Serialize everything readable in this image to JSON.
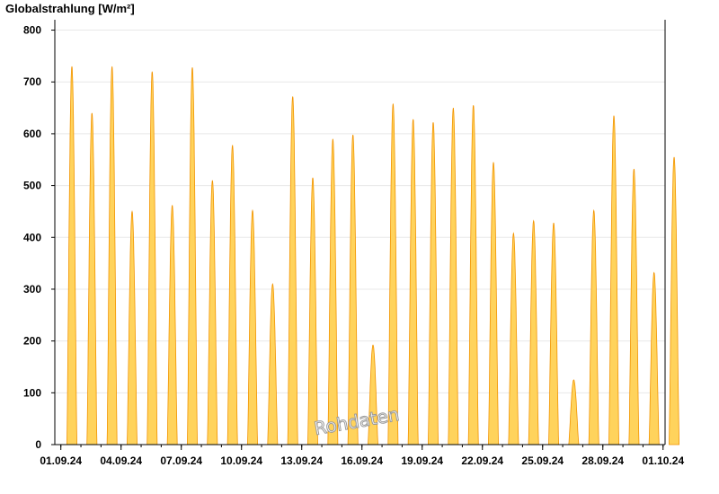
{
  "chart_data": {
    "type": "area",
    "title": "Globalstrahlung [W/m²]",
    "ylabel": "Globalstrahlung [W/m²]",
    "xlabel": "",
    "ylim": [
      0,
      820
    ],
    "yticks": [
      0,
      100,
      200,
      300,
      400,
      500,
      600,
      700,
      800
    ],
    "xlim_days": [
      -0.3,
      30.1
    ],
    "xtick_labels": [
      "01.09.24",
      "04.09.24",
      "07.09.24",
      "10.09.24",
      "13.09.24",
      "16.09.24",
      "19.09.24",
      "22.09.24",
      "25.09.24",
      "28.09.24",
      "01.10.24"
    ],
    "grid": true,
    "watermark": "Rohdaten",
    "colors": {
      "fill": "#ffd35c",
      "line": "#f29400",
      "axis": "#000000",
      "grid": "#e8e8e8"
    },
    "series": [
      {
        "days": [
          "01.09.24",
          "02.09.24",
          "03.09.24",
          "04.09.24",
          "05.09.24",
          "06.09.24",
          "07.09.24",
          "08.09.24",
          "09.09.24",
          "10.09.24",
          "11.09.24",
          "12.09.24",
          "13.09.24",
          "14.09.24",
          "15.09.24",
          "16.09.24",
          "17.09.24",
          "18.09.24",
          "19.09.24",
          "20.09.24",
          "21.09.24",
          "22.09.24",
          "23.09.24",
          "24.09.24",
          "25.09.24",
          "26.09.24",
          "27.09.24",
          "28.09.24",
          "29.09.24",
          "30.09.24",
          "01.10.24"
        ],
        "daily_peak": [
          730,
          640,
          730,
          450,
          720,
          462,
          728,
          510,
          578,
          452,
          310,
          672,
          515,
          590,
          598,
          192,
          658,
          628,
          622,
          650,
          655,
          545,
          408,
          432,
          428,
          125,
          452,
          635,
          532,
          332,
          555
        ]
      }
    ]
  }
}
